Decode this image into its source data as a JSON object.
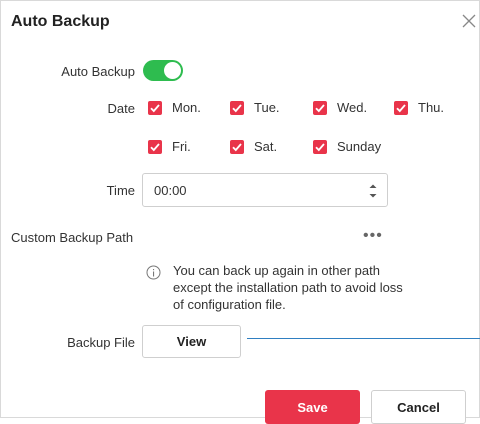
{
  "dialog": {
    "title": "Auto Backup",
    "close_icon": "close-icon"
  },
  "auto_backup": {
    "label": "Auto Backup",
    "enabled": true,
    "toggle_color": "#2ebc4f"
  },
  "date": {
    "label": "Date",
    "check_color": "#e9344a",
    "days": [
      {
        "label": "Mon.",
        "checked": true
      },
      {
        "label": "Tue.",
        "checked": true
      },
      {
        "label": "Wed.",
        "checked": true
      },
      {
        "label": "Thu.",
        "checked": true
      },
      {
        "label": "Fri.",
        "checked": true
      },
      {
        "label": "Sat.",
        "checked": true
      },
      {
        "label": "Sunday",
        "checked": true
      }
    ]
  },
  "time": {
    "label": "Time",
    "value": "00:00"
  },
  "custom_path": {
    "label": "Custom Backup Path",
    "more": "•••"
  },
  "info": {
    "icon": "info-icon",
    "text": "You can back up again in other path except the installation path to avoid loss of configuration file."
  },
  "backup_file": {
    "label": "Backup File",
    "view_label": "View"
  },
  "footer": {
    "save_label": "Save",
    "cancel_label": "Cancel"
  }
}
